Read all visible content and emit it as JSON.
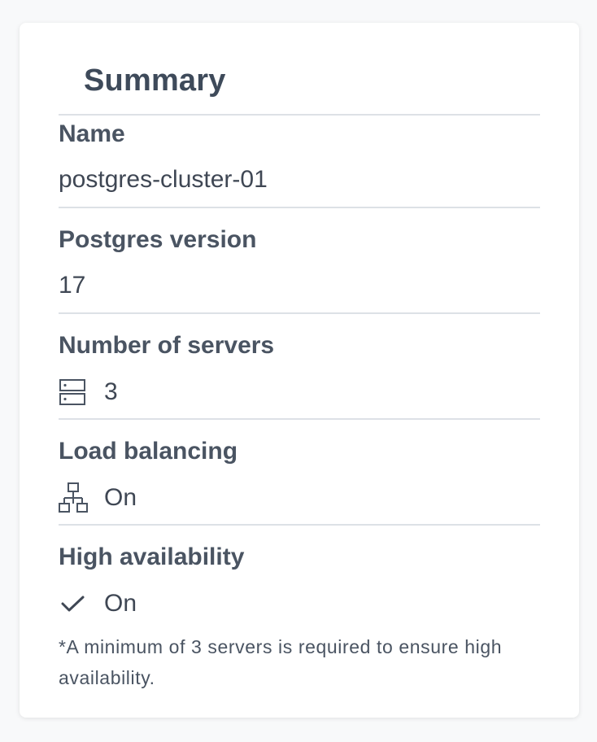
{
  "summary": {
    "title": "Summary",
    "name_label": "Name",
    "name_value": "postgres-cluster-01",
    "version_label": "Postgres version",
    "version_value": "17",
    "servers_label": "Number of servers",
    "servers_icon": "server-icon",
    "servers_value": "3",
    "lb_label": "Load balancing",
    "lb_icon": "network-hierarchy-icon",
    "lb_value": "On",
    "ha_label": "High availability",
    "ha_icon": "checkmark-icon",
    "ha_value": "On",
    "ha_note": "*A minimum of 3 servers is required to ensure high availability."
  },
  "colors": {
    "title": "#3e4a5a",
    "label": "#4a5462",
    "value": "#3f4754",
    "divider": "#dde1e6",
    "card_bg": "#ffffff",
    "page_bg": "#f8f9fa"
  }
}
